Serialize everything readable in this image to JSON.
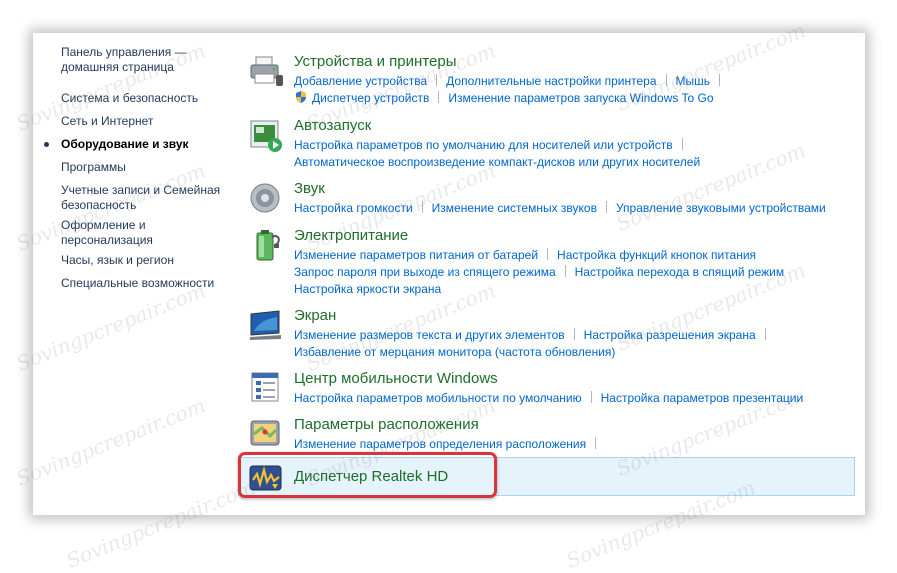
{
  "watermark": "Sovingpcrepair.com",
  "sidebar": {
    "items": [
      {
        "label": "Панель управления — домашняя страница",
        "active": false
      },
      {
        "label": "Система и безопасность",
        "active": false
      },
      {
        "label": "Сеть и Интернет",
        "active": false
      },
      {
        "label": "Оборудование и звук",
        "active": true
      },
      {
        "label": "Программы",
        "active": false
      },
      {
        "label": "Учетные записи и Семейная безопасность",
        "active": false
      },
      {
        "label": "Оформление и персонализация",
        "active": false
      },
      {
        "label": "Часы, язык и регион",
        "active": false
      },
      {
        "label": "Специальные возможности",
        "active": false
      }
    ]
  },
  "categories": {
    "devices": {
      "title": "Устройства и принтеры",
      "links": [
        "Добавление устройства",
        "Дополнительные настройки принтера",
        "Мышь",
        "Диспетчер устройств",
        "Изменение параметров запуска Windows To Go"
      ]
    },
    "autoplay": {
      "title": "Автозапуск",
      "links": [
        "Настройка параметров по умолчанию для носителей или устройств",
        "Автоматическое воспроизведение компакт-дисков или других носителей"
      ]
    },
    "sound": {
      "title": "Звук",
      "links": [
        "Настройка громкости",
        "Изменение системных звуков",
        "Управление звуковыми устройствами"
      ]
    },
    "power": {
      "title": "Электропитание",
      "links": [
        "Изменение параметров питания от батарей",
        "Настройка функций кнопок питания",
        "Запрос пароля при выходе из спящего режима",
        "Настройка перехода в спящий режим",
        "Настройка яркости экрана"
      ]
    },
    "display": {
      "title": "Экран",
      "links": [
        "Изменение размеров текста и других элементов",
        "Настройка разрешения экрана",
        "Избавление от мерцания монитора (частота обновления)"
      ]
    },
    "mobility": {
      "title": "Центр мобильности Windows",
      "links": [
        "Настройка параметров мобильности по умолчанию",
        "Настройка параметров презентации"
      ]
    },
    "location": {
      "title": "Параметры расположения",
      "links": [
        "Изменение параметров определения расположения"
      ]
    },
    "realtek": {
      "title": "Диспетчер Realtek HD"
    }
  }
}
